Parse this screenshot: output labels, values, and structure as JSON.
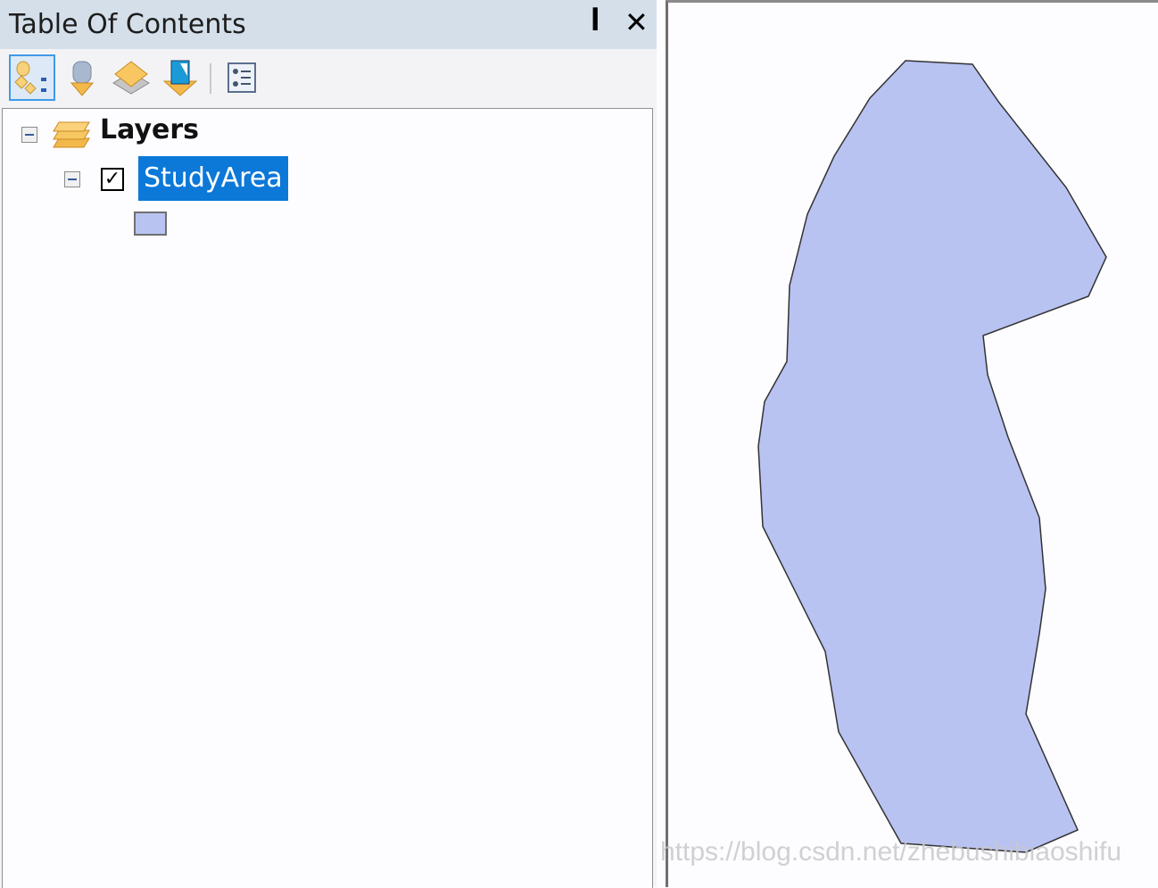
{
  "toc": {
    "title": "Table Of Contents",
    "pin_icon": "pin-icon",
    "close_icon": "close-icon",
    "toolbar": [
      "list-by-drawing-order",
      "list-by-source",
      "list-by-visibility",
      "list-by-selection",
      "options"
    ],
    "tree": {
      "root_label": "Layers",
      "layer": {
        "name": "StudyArea",
        "checked": true,
        "symbol_color": "#b8c3f2"
      }
    }
  },
  "map": {
    "fill_color": "#b8c3f2",
    "outline_color": "#333333"
  },
  "watermark": "https://blog.csdn.net/zhebushibiaoshifu",
  "colors": {
    "selection": "#0c78d8",
    "titlebar": "#d4dfea"
  }
}
